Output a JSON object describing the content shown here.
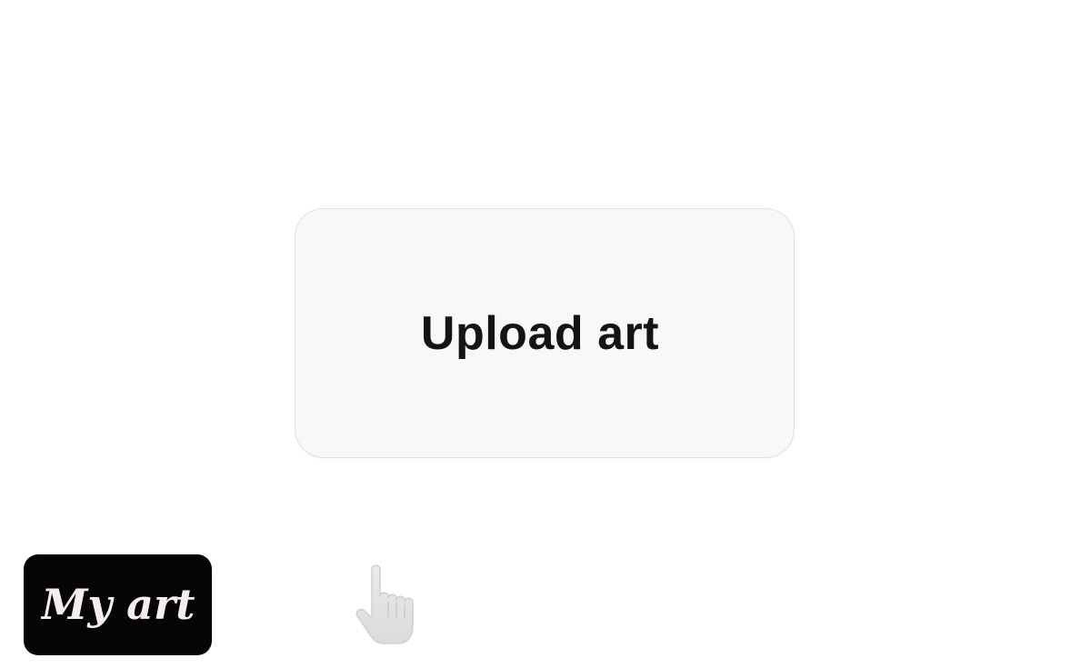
{
  "main": {
    "upload_button_label": "Upload art"
  },
  "brand": {
    "logo_text": "My art",
    "logo_background": "#050505",
    "logo_text_color": "#f6eeee"
  },
  "colors": {
    "page_background": "#ffffff",
    "button_background": "#f8f8f9",
    "button_border": "#e3dfe2",
    "label_color": "#141416",
    "cursor_fill": "#e4e2e4"
  },
  "cursor": {
    "icon": "hand-pointer-icon"
  }
}
